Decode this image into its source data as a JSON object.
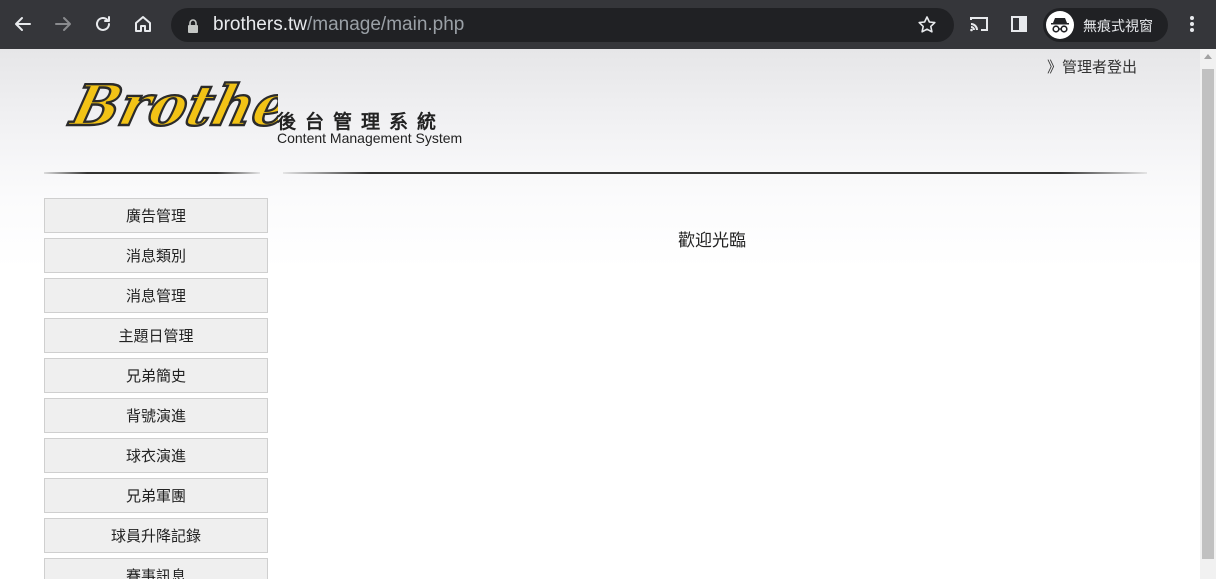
{
  "browser": {
    "url_host": "brothers.tw",
    "url_path": "/manage/main.php",
    "profile_label": "無痕式視窗",
    "icons": [
      "back-arrow-icon",
      "forward-arrow-icon",
      "reload-icon",
      "home-icon",
      "lock-icon",
      "star-icon",
      "cast-icon",
      "side-panel-icon",
      "incognito-icon",
      "more-vert-icon"
    ]
  },
  "header": {
    "logo_text": "Brothers",
    "title_cn": "後台管理系統",
    "title_en": "Content Management System",
    "logout_label": "》管理者登出"
  },
  "sidebar": {
    "items": [
      {
        "label": "廣告管理"
      },
      {
        "label": "消息類別"
      },
      {
        "label": "消息管理"
      },
      {
        "label": "主題日管理"
      },
      {
        "label": "兄弟簡史"
      },
      {
        "label": "背號演進"
      },
      {
        "label": "球衣演進"
      },
      {
        "label": "兄弟軍團"
      },
      {
        "label": "球員升降記錄"
      },
      {
        "label": "賽事訊息"
      }
    ]
  },
  "main": {
    "welcome": "歡迎光臨"
  },
  "colors": {
    "logo_yellow": "#f2c316",
    "logo_outline": "#2b2b2b",
    "chrome_bg": "#35363a"
  }
}
